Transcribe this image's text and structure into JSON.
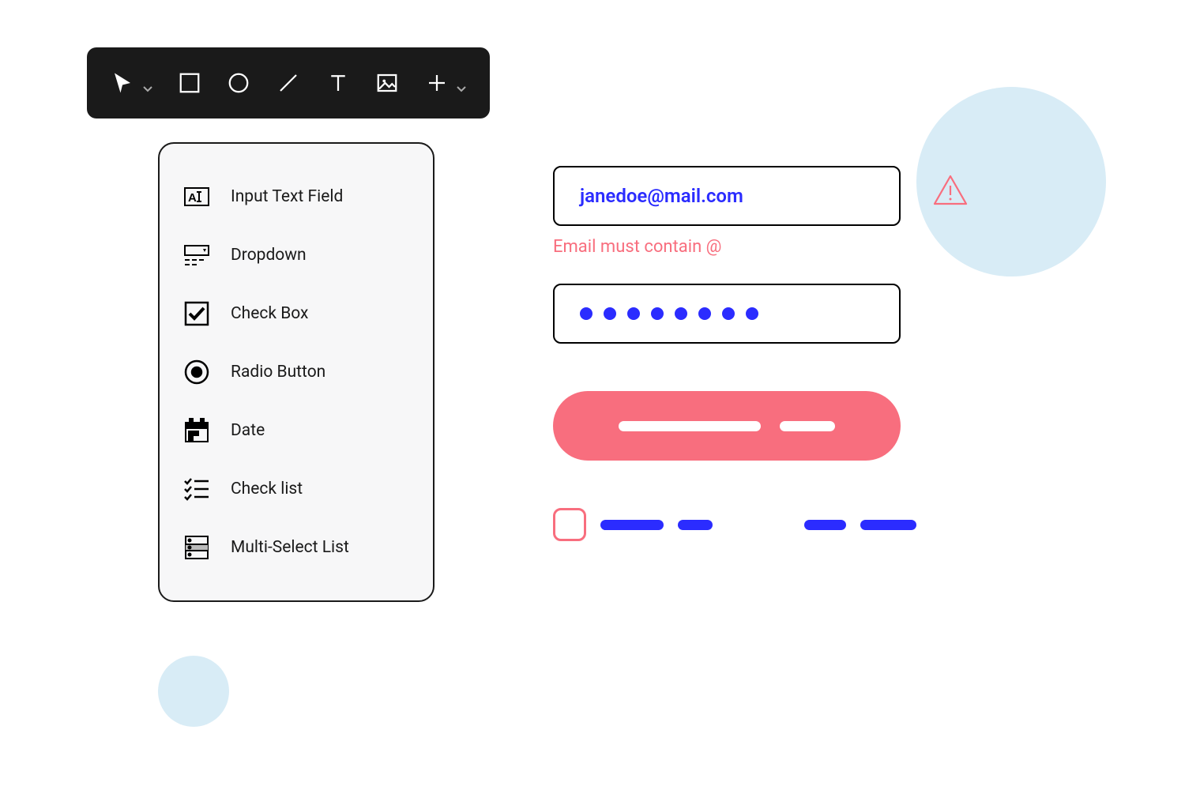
{
  "toolbar": {
    "items": [
      {
        "name": "pointer",
        "has_dropdown": true
      },
      {
        "name": "rectangle",
        "has_dropdown": false
      },
      {
        "name": "circle",
        "has_dropdown": false
      },
      {
        "name": "line",
        "has_dropdown": false
      },
      {
        "name": "text",
        "has_dropdown": false
      },
      {
        "name": "image",
        "has_dropdown": false
      },
      {
        "name": "add",
        "has_dropdown": true
      }
    ]
  },
  "palette": {
    "items": [
      {
        "icon": "input-text-icon",
        "label": "Input Text Field"
      },
      {
        "icon": "dropdown-icon",
        "label": "Dropdown"
      },
      {
        "icon": "checkbox-icon",
        "label": "Check Box"
      },
      {
        "icon": "radio-icon",
        "label": "Radio Button"
      },
      {
        "icon": "date-icon",
        "label": "Date"
      },
      {
        "icon": "checklist-icon",
        "label": "Check list"
      },
      {
        "icon": "multiselect-icon",
        "label": "Multi-Select List"
      }
    ]
  },
  "form": {
    "email_value": "janedoe@mail.com",
    "email_error": "Email must contain @",
    "password_mask_length": 8,
    "colors": {
      "primary_blue": "#2b2cff",
      "error_pink": "#f86e7e",
      "decor_blue": "#d8ecf6"
    }
  }
}
